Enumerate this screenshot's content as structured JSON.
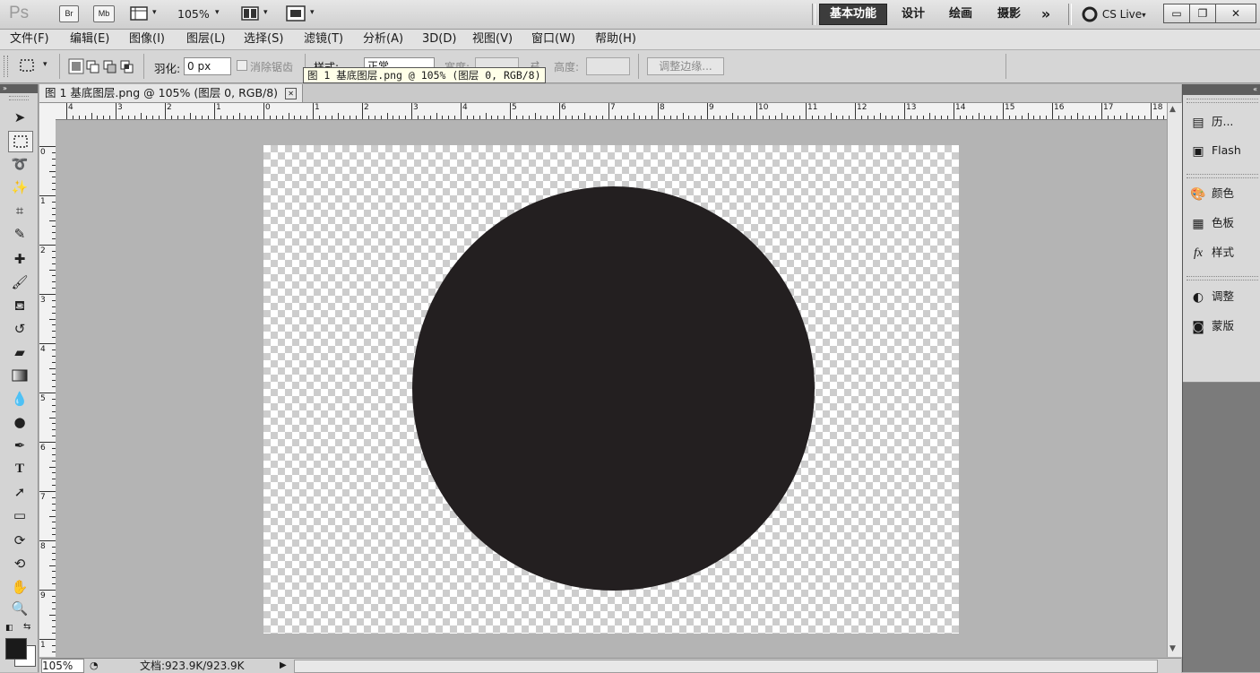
{
  "appbar": {
    "logo": "Ps",
    "bridge_label": "Br",
    "minibridge_label": "Mb",
    "zoom": "105%",
    "workspaces": [
      "基本功能",
      "设计",
      "绘画",
      "摄影"
    ],
    "more": "»",
    "cs_live": "CS Live",
    "caret": "▾"
  },
  "menu": [
    "文件(F)",
    "编辑(E)",
    "图像(I)",
    "图层(L)",
    "选择(S)",
    "滤镜(T)",
    "分析(A)",
    "3D(D)",
    "视图(V)",
    "窗口(W)",
    "帮助(H)"
  ],
  "options": {
    "feather_label": "羽化:",
    "feather_value": "0 px",
    "antialias_label": "消除锯齿",
    "style_label": "样式:",
    "style_value": "正常",
    "width_label": "宽度:",
    "height_label": "高度:",
    "refine_button": "调整边缘..."
  },
  "tooltip": "图 1  基底图层.png @ 105% (图层 0, RGB/8)",
  "document": {
    "tab_title": "图 1  基底图层.png @ 105% (图层 0, RGB/8)",
    "close_glyph": "✕",
    "circle_color": "#231f20"
  },
  "rulers": {
    "h_labels": [
      "4",
      "3",
      "2",
      "1",
      "0",
      "1",
      "2",
      "3",
      "4",
      "5",
      "6",
      "7",
      "8",
      "9",
      "10",
      "11",
      "12",
      "13",
      "14",
      "15",
      "16",
      "17",
      "18"
    ],
    "v_labels": [
      "0",
      "1",
      "2",
      "3",
      "4",
      "5",
      "6",
      "7",
      "8",
      "9",
      "1"
    ]
  },
  "status": {
    "zoom": "105%",
    "doc_info": "文档:923.9K/923.9K"
  },
  "panels": [
    {
      "icon": "history-icon",
      "label": "历..."
    },
    {
      "icon": "flash-icon",
      "label": "Flash"
    },
    {
      "icon": "color-icon",
      "label": "颜色"
    },
    {
      "icon": "swatches-icon",
      "label": "色板"
    },
    {
      "icon": "styles-icon",
      "label": "样式"
    },
    {
      "icon": "adjustments-icon",
      "label": "调整"
    },
    {
      "icon": "masks-icon",
      "label": "蒙版"
    }
  ],
  "colors": {
    "foreground": "#1a1a1a",
    "background": "#ffffff"
  }
}
